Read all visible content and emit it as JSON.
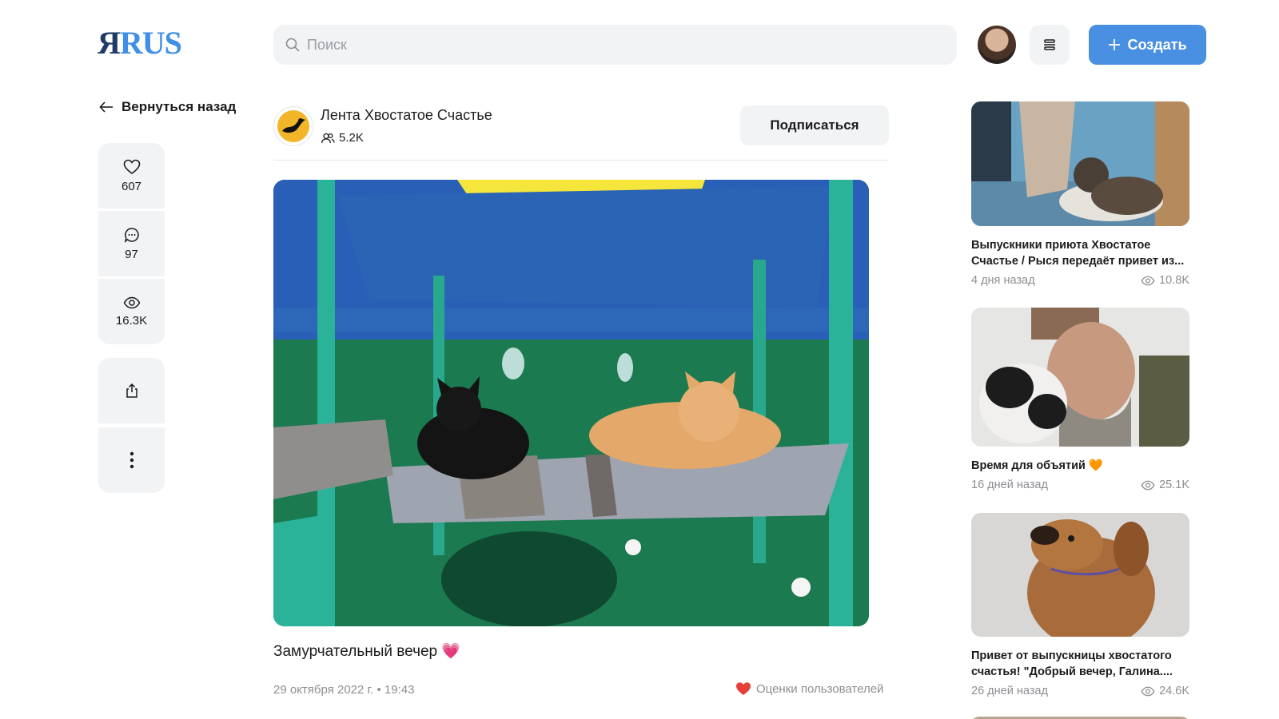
{
  "header": {
    "logo_ya": "Я",
    "logo_rus": "RUS",
    "search_placeholder": "Поиск",
    "create_label": "Создать"
  },
  "sidebar": {
    "back_label": "Вернуться назад",
    "likes": "607",
    "comments": "97",
    "views": "16.3K"
  },
  "channel": {
    "name": "Лента Хвостатое Счастье",
    "subscribers": "5.2K",
    "subscribe_label": "Подписаться"
  },
  "post": {
    "title": "Замурчательный вечер 💗",
    "date": "29 октября 2022 г. • 19:43",
    "rating_label": "Оценки пользователей"
  },
  "recommendations": [
    {
      "title": "Выпускники приюта Хвостатое Счастье / Рыся передаёт привет из...",
      "age": "4 дня назад",
      "views": "10.8K"
    },
    {
      "title": "Время для объятий 🧡",
      "age": "16 дней назад",
      "views": "25.1K"
    },
    {
      "title": "Привет от выпускницы хвостатого счастья! \"Добрый вечер, Галина....",
      "age": "26 дней назад",
      "views": "24.6K"
    }
  ],
  "colors": {
    "accent": "#4a90e2",
    "surface": "#f2f3f5",
    "muted_text": "#8e8e93"
  }
}
